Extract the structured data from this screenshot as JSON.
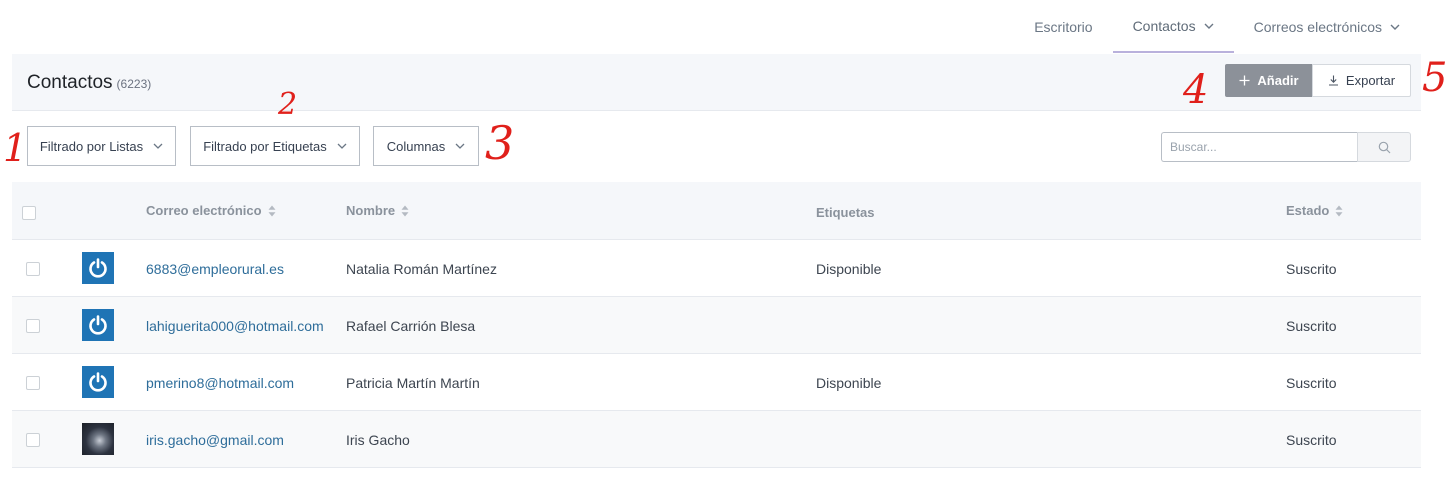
{
  "nav": {
    "items": [
      {
        "label": "Escritorio",
        "dropdown": false,
        "active": false
      },
      {
        "label": "Contactos",
        "dropdown": true,
        "active": true
      },
      {
        "label": "Correos electrónicos",
        "dropdown": true,
        "active": false
      }
    ]
  },
  "header": {
    "title": "Contactos",
    "count": "(6223)",
    "add_label": "Añadir",
    "export_label": "Exportar"
  },
  "filters": {
    "lists_label": "Filtrado por Listas",
    "tags_label": "Filtrado por Etiquetas",
    "columns_label": "Columnas",
    "search_placeholder": "Buscar..."
  },
  "annotations": [
    "1",
    "2",
    "3",
    "4",
    "5"
  ],
  "table": {
    "columns": {
      "email": "Correo electrónico",
      "name": "Nombre",
      "tags": "Etiquetas",
      "status": "Estado"
    },
    "rows": [
      {
        "avatar": "power-icon",
        "email": "6883@empleorural.es",
        "name": "Natalia Román Martínez",
        "tags": "Disponible",
        "status": "Suscrito"
      },
      {
        "avatar": "power-icon",
        "email": "lahiguerita000@hotmail.com",
        "name": "Rafael Carrión Blesa",
        "tags": "",
        "status": "Suscrito"
      },
      {
        "avatar": "power-icon",
        "email": "pmerino8@hotmail.com",
        "name": "Patricia Martín Martín",
        "tags": "Disponible",
        "status": "Suscrito"
      },
      {
        "avatar": "photo",
        "email": "iris.gacho@gmail.com",
        "name": "Iris Gacho",
        "tags": "",
        "status": "Suscrito"
      }
    ]
  },
  "colors": {
    "accent_underline": "#b9b1dc",
    "add_button": "#8c9199",
    "avatar_blue": "#1f74b5",
    "link": "#2e6d9a",
    "annotation_red": "#e0201b"
  }
}
